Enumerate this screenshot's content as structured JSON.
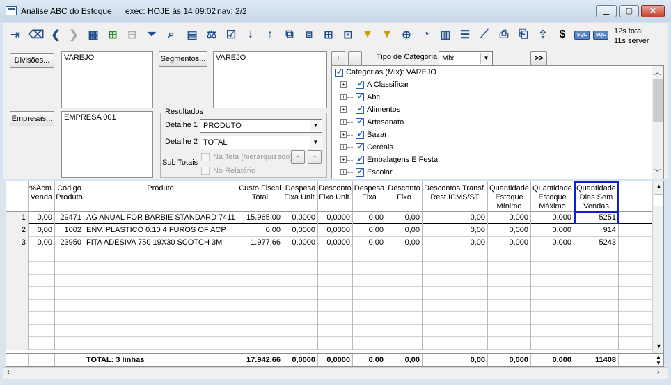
{
  "window": {
    "title": "Análise ABC do Estoque",
    "exec": "exec: HOJE às 14:09:02",
    "nav": "nav: 2/2"
  },
  "stats": {
    "line1": "12s  total",
    "line2": "11s  server"
  },
  "filters": {
    "divisoes_btn": "Divisões...",
    "divisoes_val": "VAREJO",
    "segmentos_btn": "Segmentos...",
    "segmentos_val": "VAREJO",
    "empresas_btn": "Empresas...",
    "empresas_val": "EMPRESA 001",
    "resultados": "Resultados",
    "detalhe1_label": "Detalhe 1",
    "detalhe1_val": "PRODUTO",
    "detalhe2_label": "Detalhe 2",
    "detalhe2_val": "TOTAL",
    "subtotais": "Sub Totais",
    "na_tela": "Na Tela (hierarquizado)",
    "no_relatorio": "No Relatório",
    "tipo_categoria_label": "Tipo de Categoria",
    "tipo_categoria_val": "Mix",
    "more": ">>"
  },
  "tree": {
    "root": "Categorias (Mix): VAREJO",
    "items": [
      "A Classificar",
      "Abc",
      "Alimentos",
      "Artesanato",
      "Bazar",
      "Cereais",
      "Embalagens E Festa",
      "Escolar"
    ]
  },
  "grid": {
    "headers": [
      "",
      "%Acm.\nVenda",
      "Código\nProduto",
      "Produto",
      "Custo Fiscal\nTotal",
      "Despesa\nFixa Unit.",
      "Desconto\nFixo Unit.",
      "Despesa\nFixa",
      "Desconto\nFixo",
      "Descontos Transf.\nRest.ICMS/ST",
      "Quantidade\nEstoque\nMínimo",
      "Quantidade\nEstoque\nMáximo",
      "Quantidade\nDias Sem\nVendas"
    ],
    "rows": [
      [
        "1",
        "0,00",
        "29471",
        "AG ANUAL FOR BARBIE STANDARD 7411",
        "15.965,00",
        "0,0000",
        "0,0000",
        "0,00",
        "0,00",
        "0,00",
        "0,000",
        "0,000",
        "5251"
      ],
      [
        "2",
        "0,00",
        "1002",
        "ENV. PLASTICO 0.10 4 FUROS OF ACP",
        "0,00",
        "0,0000",
        "0,0000",
        "0,00",
        "0,00",
        "0,00",
        "0,000",
        "0,000",
        "914"
      ],
      [
        "3",
        "0,00",
        "23950",
        "FITA ADESIVA 750 19X30 SCOTCH 3M",
        "1.977,66",
        "0,0000",
        "0,0000",
        "0,00",
        "0,00",
        "0,00",
        "0,000",
        "0,000",
        "5243"
      ]
    ],
    "total": [
      "",
      "",
      "",
      "TOTAL: 3 linhas",
      "17.942,66",
      "0,0000",
      "0,0000",
      "0,00",
      "0,00",
      "0,00",
      "0,000",
      "0,000",
      "11408"
    ]
  },
  "colors": {
    "accent": "#1f4e8c",
    "highlight": "#1020c8"
  }
}
